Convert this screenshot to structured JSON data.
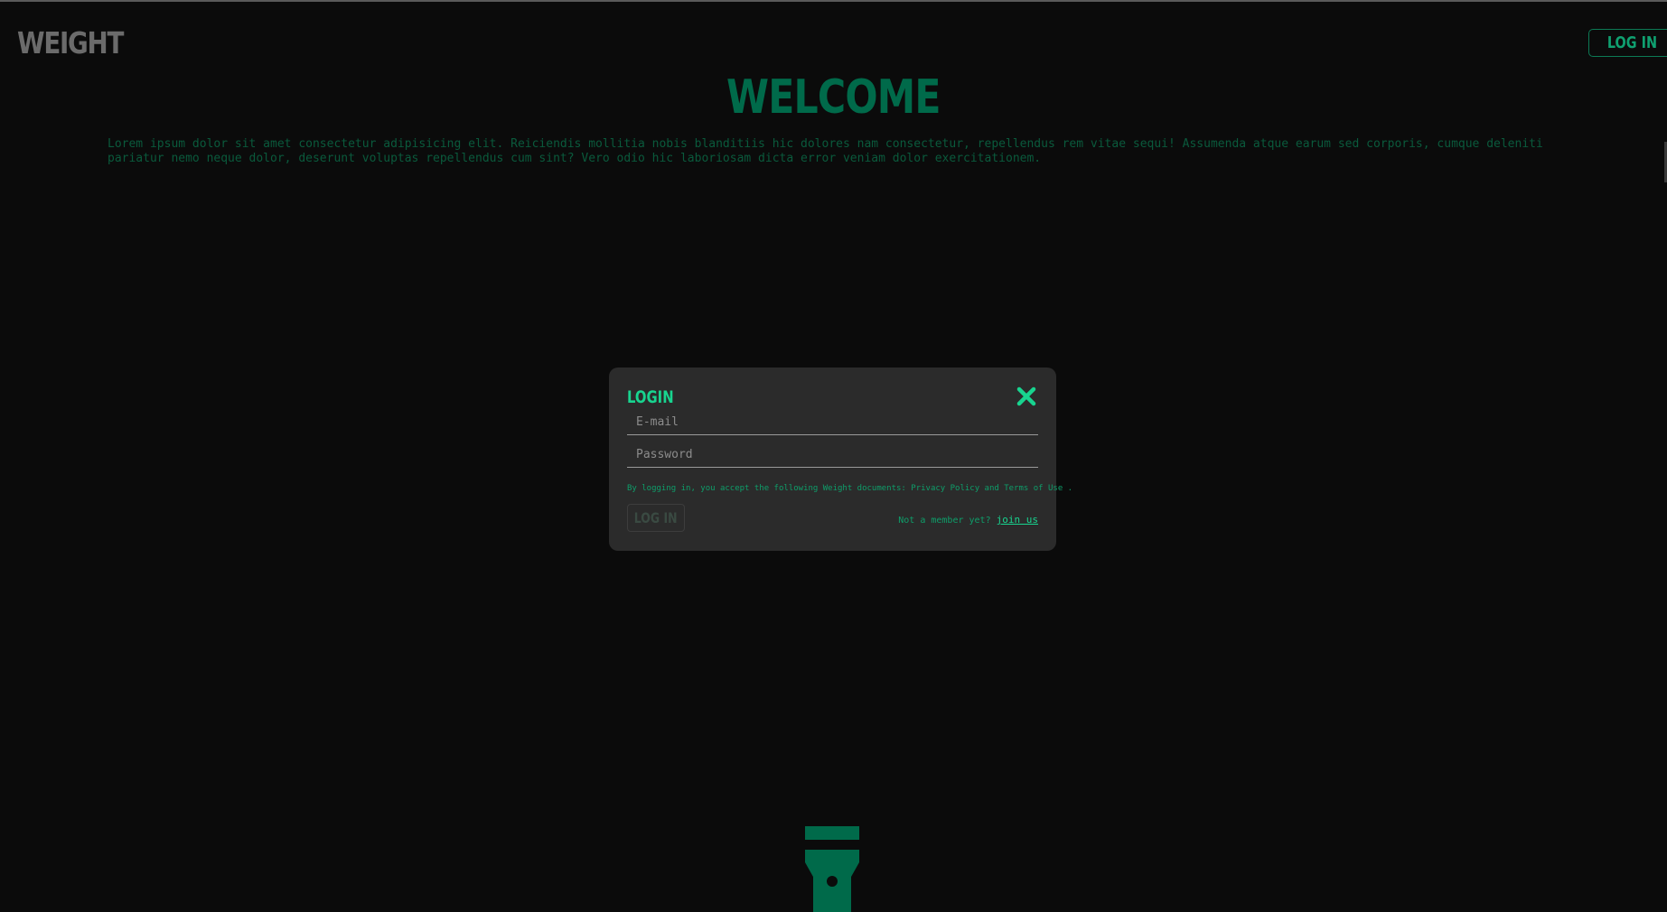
{
  "header": {
    "logo": "WEIGHT",
    "login_button": "LOG IN"
  },
  "hero": {
    "title": "WELCOME",
    "text": "Lorem ipsum dolor sit amet consectetur adipisicing elit. Reiciendis mollitia nobis blanditiis hic dolores nam consectetur, repellendus rem vitae sequi! Assumenda atque earum sed corporis, cumque deleniti pariatur nemo neque dolor, deserunt voluptas repellendus cum sint? Vero odio hic laboriosam dicta error veniam dolor exercitationem."
  },
  "modal": {
    "title": "LOGIN",
    "email_placeholder": "E-mail",
    "password_placeholder": "Password",
    "terms": "By logging in, you accept the following Weight documents: Privacy Policy and Terms of Use .",
    "submit_label": "LOG IN",
    "signup_prompt": "Not a member yet?",
    "signup_link": "join us"
  },
  "icons": {
    "close": "close-icon",
    "flashlight": "flashlight-icon"
  },
  "colors": {
    "background": "#0b0b0b",
    "modal_background": "#2b2b2b",
    "accent": "#18d48f",
    "accent_dark": "#006a4a"
  }
}
